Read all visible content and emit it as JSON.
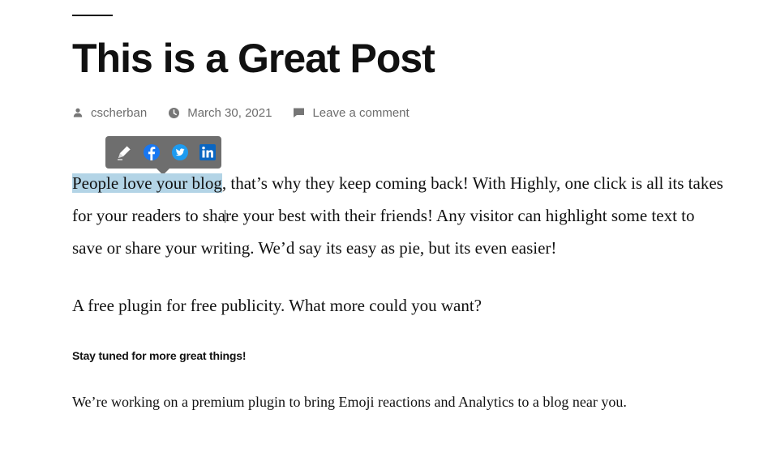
{
  "post": {
    "title": "This is a Great Post",
    "meta": {
      "author": "cscherban",
      "date": "March 30, 2021",
      "comments": "Leave a comment"
    },
    "paragraph1": {
      "highlighted": "People love your blog",
      "part_a": ", that’s why they keep coming back! With Highly, one click is all its takes for your readers to sha",
      "part_b": "re your best with their friends! Any visitor can highlight some text to save or share your writing. We’d say its easy as pie, but its even easier!"
    },
    "paragraph2": "A free plugin for free publicity. What more could you want?",
    "subheading": "Stay tuned for more great things!",
    "paragraph3": "We’re working on a premium plugin to bring Emoji reactions and Analytics to a blog near you."
  },
  "share_toolbar": {
    "icons": [
      "pencil-icon",
      "facebook-icon",
      "twitter-icon",
      "linkedin-icon"
    ],
    "colors": {
      "background": "#6e6e6e",
      "facebook": "#1877f2",
      "twitter": "#1d9bf0",
      "linkedin": "#0a66c2",
      "highlight": "#b3d4e6"
    }
  }
}
